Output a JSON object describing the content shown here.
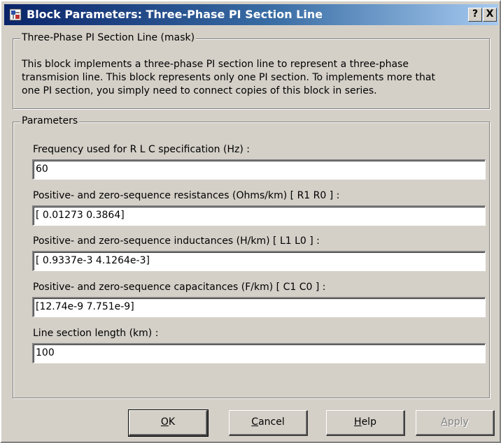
{
  "window": {
    "title": "Block Parameters: Three-Phase PI Section Line",
    "help_button": "?",
    "close_button": "X"
  },
  "mask_group": {
    "legend": "Three-Phase PI Section Line (mask)",
    "description_lines": [
      "This block implements a three-phase PI section line to represent a three-phase",
      "transmision line. This block represents only  one PI section.  To implements more that",
      "one PI section,  you  simply need to connect  copies of this block in series."
    ]
  },
  "parameters_group": {
    "legend": "Parameters",
    "fields": [
      {
        "label": "Frequency used for R L C specification (Hz) :",
        "value": "60"
      },
      {
        "label": "Positive- and zero-sequence resistances (Ohms/km)  [ R1  R0 ] :",
        "value": "[ 0.01273 0.3864]"
      },
      {
        "label": "Positive- and zero-sequence inductances (H/km) [ L1  L0 ] :",
        "value": "[ 0.9337e-3  4.1264e-3]"
      },
      {
        "label": "Positive- and zero-sequence capacitances (F/km)  [ C1 C0 ] :",
        "value": "[12.74e-9 7.751e-9]"
      },
      {
        "label": "Line section length (km) :",
        "value": "100"
      }
    ]
  },
  "buttons": {
    "ok": {
      "mnemonic": "O",
      "rest": "K"
    },
    "cancel": {
      "mnemonic": "C",
      "rest": "ancel"
    },
    "help": {
      "mnemonic": "H",
      "rest": "elp"
    },
    "apply": {
      "mnemonic": "A",
      "rest": "pply"
    }
  }
}
